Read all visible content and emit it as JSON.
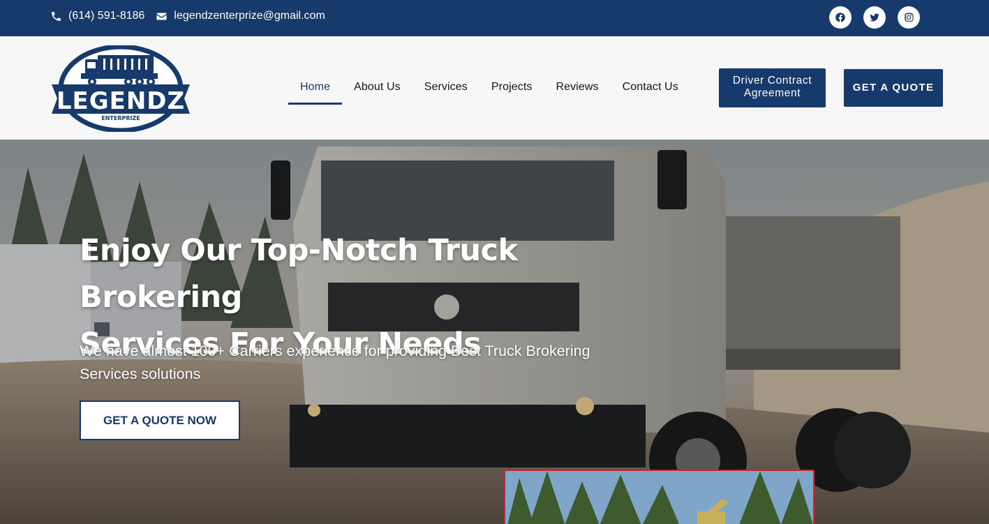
{
  "topbar": {
    "phone": "(614) 591-8186",
    "email": "legendzenterprize@gmail.com",
    "socials": [
      "facebook-icon",
      "twitter-icon",
      "instagram-icon"
    ]
  },
  "header": {
    "logo": {
      "name": "LEGENDZ",
      "tagline": "ENTERPRIZE"
    },
    "nav": [
      "Home",
      "About Us",
      "Services",
      "Projects",
      "Reviews",
      "Contact Us"
    ],
    "active_nav": "Home",
    "driver_button": "Driver Contract Agreement",
    "quote_button": "GET A QUOTE"
  },
  "hero": {
    "title_line1": "Enjoy Our Top-Notch Truck Brokering",
    "title_line2": "Services For Your Needs",
    "subtitle_line1": "We have almost 100+ Carriers experience for providing Best Truck Brokering",
    "subtitle_line2": "Services solutions",
    "cta": "GET A QUOTE NOW"
  },
  "colors": {
    "brand": "#163a6b",
    "header_bg": "#f7f7f8",
    "thumb_border": "#c42a2a"
  }
}
